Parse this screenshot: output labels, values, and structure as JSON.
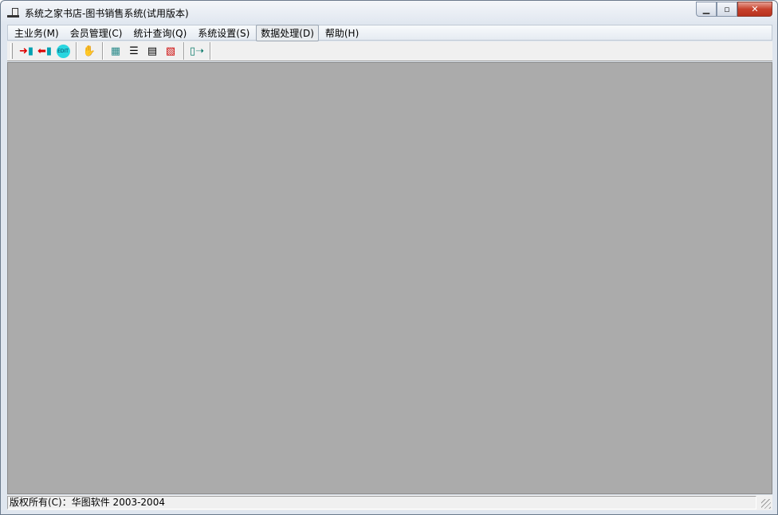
{
  "window": {
    "title": "系统之家书店-图书销售系统(试用版本)"
  },
  "menu": [
    {
      "label": "主业务(M)"
    },
    {
      "label": "会员管理(C)"
    },
    {
      "label": "统计查询(Q)"
    },
    {
      "label": "系统设置(S)"
    },
    {
      "label": "数据处理(D)"
    },
    {
      "label": "帮助(H)"
    }
  ],
  "toolbar": {
    "edit_label": "EDIT"
  },
  "status": {
    "copyright": "版权所有(C)：华图软件 2003-2004"
  },
  "colors": {
    "mdi_background": "#ababab",
    "close_button": "#c7412c"
  }
}
